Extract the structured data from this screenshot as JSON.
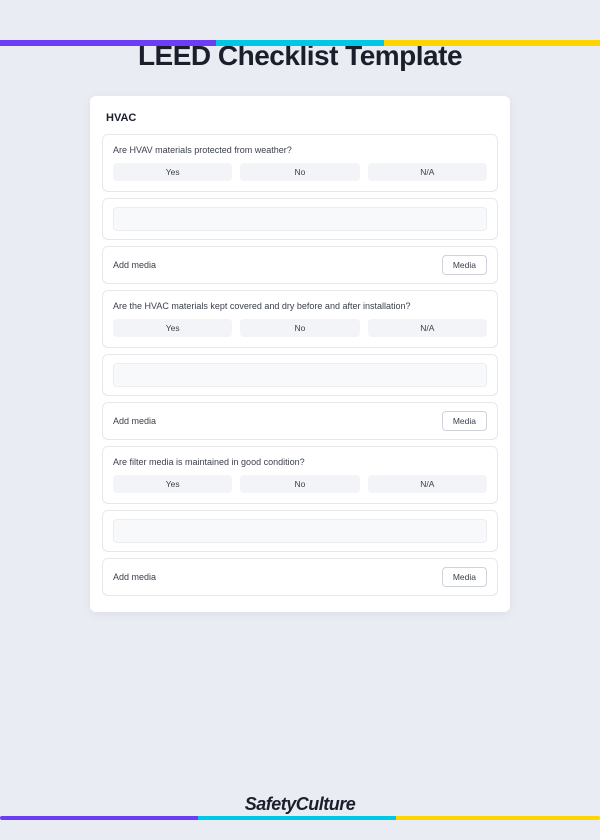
{
  "title": "LEED Checklist Template",
  "section_title": "HVAC",
  "choices": {
    "yes": "Yes",
    "no": "No",
    "na": "N/A"
  },
  "add_media_label": "Add media",
  "media_button": "Media",
  "questions": [
    {
      "text": "Are HVAV materials protected from weather?"
    },
    {
      "text": "Are the HVAC materials kept covered and dry before and after installation?"
    },
    {
      "text": "Are filter media is maintained in good condition?"
    }
  ],
  "brand": "SafetyCulture"
}
